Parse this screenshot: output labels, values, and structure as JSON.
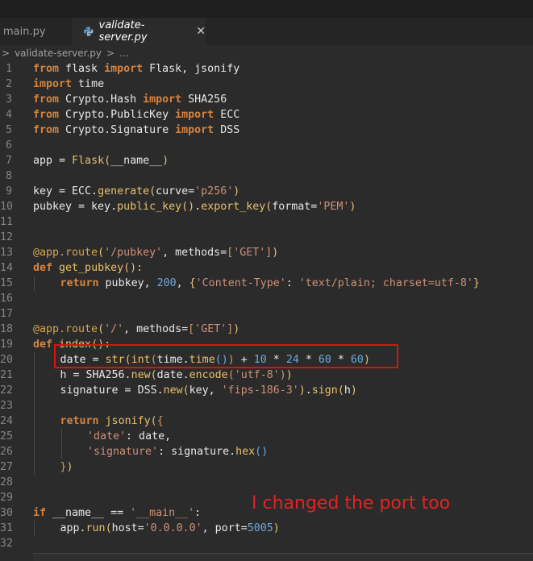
{
  "tabs": [
    {
      "label": "main.py",
      "active": false
    },
    {
      "label": "validate-server.py",
      "active": true
    }
  ],
  "breadcrumb": {
    "file": "validate-server.py",
    "sep": ">",
    "more": "..."
  },
  "code_lines": [
    {
      "n": "1"
    },
    {
      "n": "2"
    },
    {
      "n": "3"
    },
    {
      "n": "4"
    },
    {
      "n": "5"
    },
    {
      "n": "6"
    },
    {
      "n": "7"
    },
    {
      "n": "8"
    },
    {
      "n": "9"
    },
    {
      "n": "10"
    },
    {
      "n": "11"
    },
    {
      "n": "12"
    },
    {
      "n": "13"
    },
    {
      "n": "14"
    },
    {
      "n": "15"
    },
    {
      "n": "16"
    },
    {
      "n": "17"
    },
    {
      "n": "18"
    },
    {
      "n": "19"
    },
    {
      "n": "20"
    },
    {
      "n": "21"
    },
    {
      "n": "22"
    },
    {
      "n": "23"
    },
    {
      "n": "24"
    },
    {
      "n": "25"
    },
    {
      "n": "26"
    },
    {
      "n": "27"
    },
    {
      "n": "28"
    },
    {
      "n": "29"
    },
    {
      "n": "30"
    },
    {
      "n": "31"
    },
    {
      "n": "32"
    }
  ],
  "tokens": {
    "from": "from",
    "import": "import",
    "def": "def",
    "return": "return",
    "if": "if",
    "flask": " flask ",
    "flask_imports": " Flask, jsonify",
    "time": " time",
    "crypto_hash": " Crypto.Hash ",
    "sha256": " SHA256",
    "crypto_pk": " Crypto.PublicKey ",
    "ecc": " ECC",
    "crypto_sig": " Crypto.Signature ",
    "dss": " DSS",
    "app_assign": "app = ",
    "Flask": "Flask",
    "name_arg": "__name__",
    "key_assign": "key = ECC.",
    "generate": "generate",
    "curve_kw": "curve=",
    "p256": "'p256'",
    "pubkey_assign": "pubkey = key.",
    "public_key": "public_key",
    "dot": ".",
    "export_key": "export_key",
    "format_kw": "format=",
    "pem": "'PEM'",
    "route_dec": "@app.route",
    "route_pubkey": "'/pubkey'",
    "methods_kw": ", methods=",
    "get": "'GET'",
    "get_pubkey": " get_pubkey",
    "ret_pubkey": " pubkey, ",
    "n200": "200",
    "ct_key": "'Content-Type'",
    "colon": ": ",
    "ct_val": "'text/plain; charset=utf-8'",
    "route_root": "'/'",
    "index": " index",
    "date_assign": "date = ",
    "str": "str",
    "int": "int",
    "time_pre": "time.",
    "timefn": "time",
    "plus": " + ",
    "n10": "10",
    "mul": " * ",
    "n24": "24",
    "n60": "60",
    "h_assign": "h = SHA256.",
    "new": "new",
    "date_dot": "date.",
    "encode": "encode",
    "utf8": "'utf-8'",
    "sig_assign": "signature = DSS.",
    "key_arg": "key, ",
    "fips": "'fips-186-3'",
    "sign": "sign",
    "h_arg": "h",
    "jsonify": " jsonify",
    "date_key": "'date'",
    "date_val": ": date,",
    "sig_key": "'signature'",
    "sig_val": ": signature.",
    "hex": "hex",
    "name_cmp": " __name__ == ",
    "main_str": "'__main__'",
    "colon_end": ":",
    "app_dot": "app.",
    "run": "run",
    "host_kw": "host=",
    "host_val": "'0.0.0.0'",
    "port_kw": ", port=",
    "port_val": "5005",
    "lparen": "(",
    "rparen": ")",
    "lbrack": "[",
    "rbrack": "]",
    "lbrace": "{",
    "rbrace": "}",
    "comma_sp": ", ",
    "call_end": "():"
  },
  "annotation": {
    "text": "I changed the port too",
    "color": "#e52222"
  },
  "colors": {
    "keyword": "#d6843e",
    "string": "#ce9178",
    "number": "#6fa8dc",
    "function": "#e8c06a",
    "highlight_box": "#e01010"
  }
}
